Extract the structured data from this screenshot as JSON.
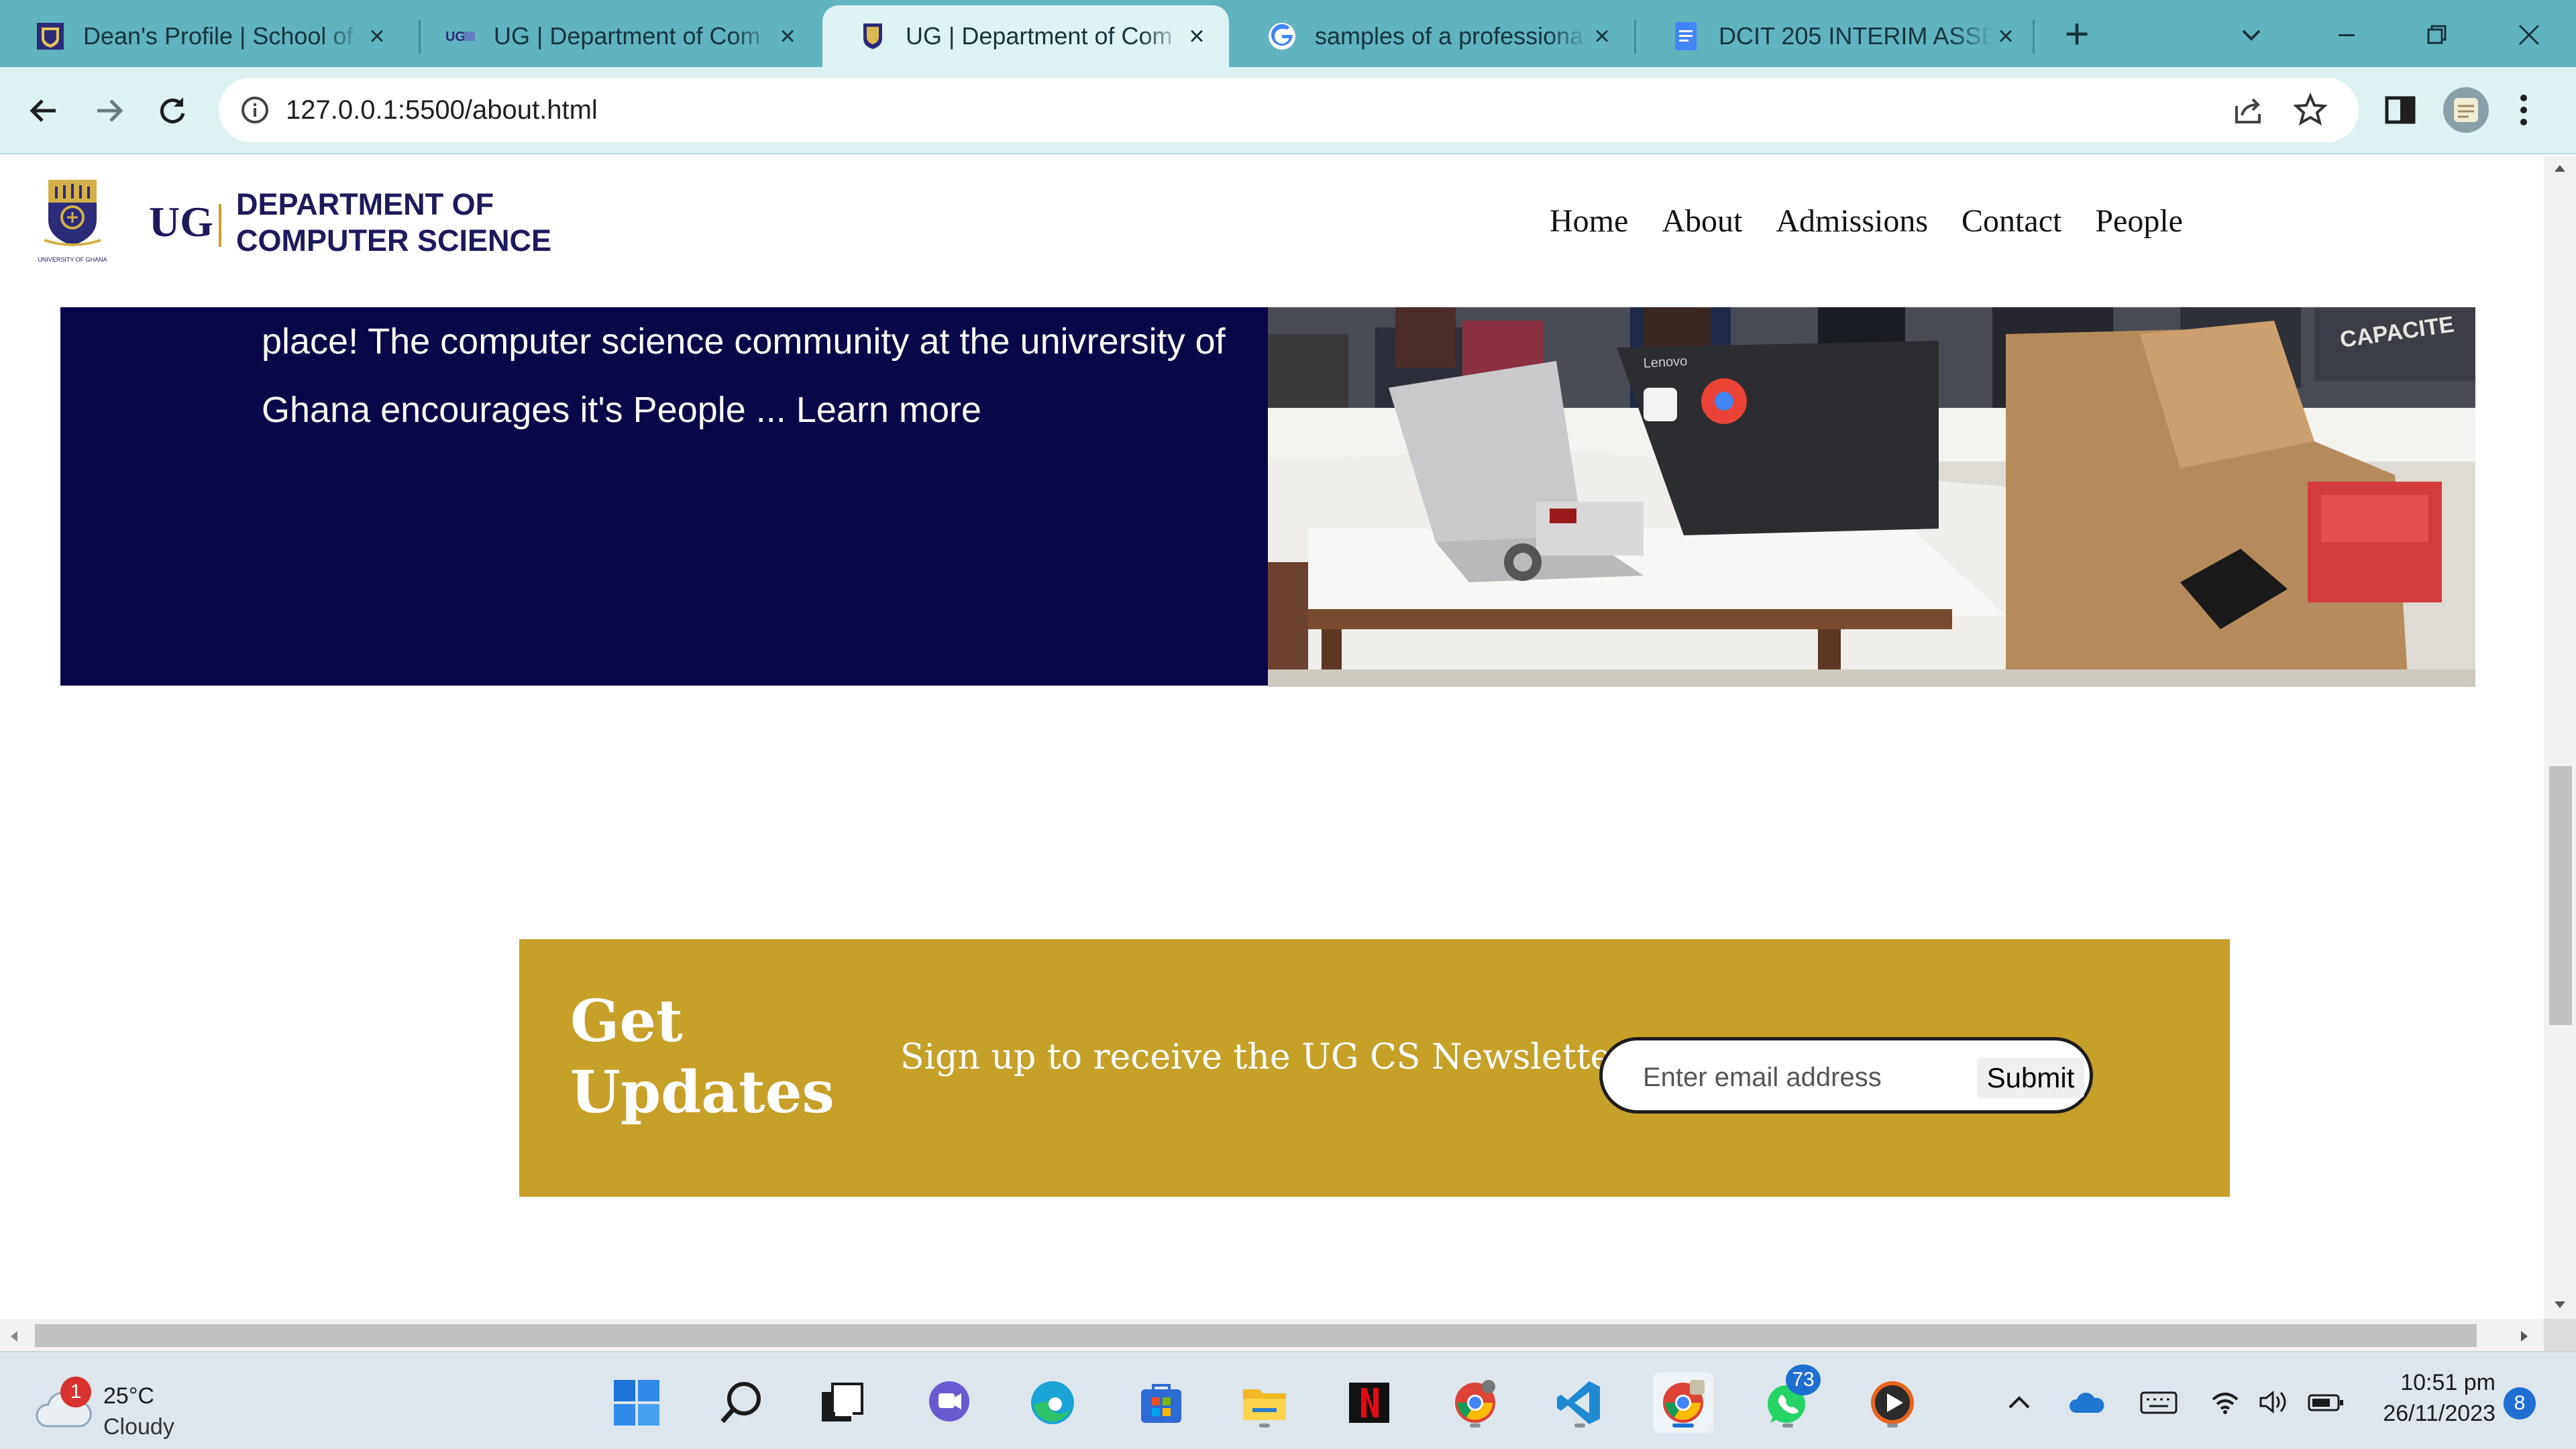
{
  "browser": {
    "tabs": [
      {
        "title": "Dean's Profile | School of",
        "icon": "ug-crest-icon",
        "active": false
      },
      {
        "title": "UG | Department of Com",
        "icon": "ug-logo-icon",
        "active": false
      },
      {
        "title": "UG | Department of Com",
        "icon": "ug-crest-icon",
        "active": true
      },
      {
        "title": "samples of a professiona",
        "icon": "google-icon",
        "active": false
      },
      {
        "title": "DCIT 205 INTERIM ASSES",
        "icon": "docs-icon",
        "active": false
      }
    ],
    "url": "127.0.0.1:5500/about.html"
  },
  "site": {
    "logo_caption": "UNIVERSITY OF GHANA",
    "ug_text": "UG",
    "dept_name": "DEPARTMENT OF COMPUTER SCIENCE",
    "nav": [
      "Home",
      "About",
      "Admissions",
      "Contact",
      "People"
    ]
  },
  "hero": {
    "text": "place! The computer science community at the univrersity of Ghana encourages it's People ...",
    "link": "Learn more",
    "image_laptop_brand": "Lenovo",
    "image_box_text": "CAPACITE"
  },
  "newsletter": {
    "title": "Get Updates",
    "subtitle": "Sign up to receive the UG CS Newsletter",
    "placeholder": "Enter email address",
    "submit": "Submit"
  },
  "taskbar": {
    "weather_temp": "25°C",
    "weather_desc": "Cloudy",
    "weather_badge": "1",
    "whatsapp_badge": "73",
    "time": "10:51 pm",
    "date": "26/11/2023",
    "notification_count": "8"
  },
  "colors": {
    "tab_strip": "#5fb4be",
    "hero_navy": "#070749",
    "newsletter_gold": "#c7a02a",
    "brand_text": "#1d1a5c"
  }
}
